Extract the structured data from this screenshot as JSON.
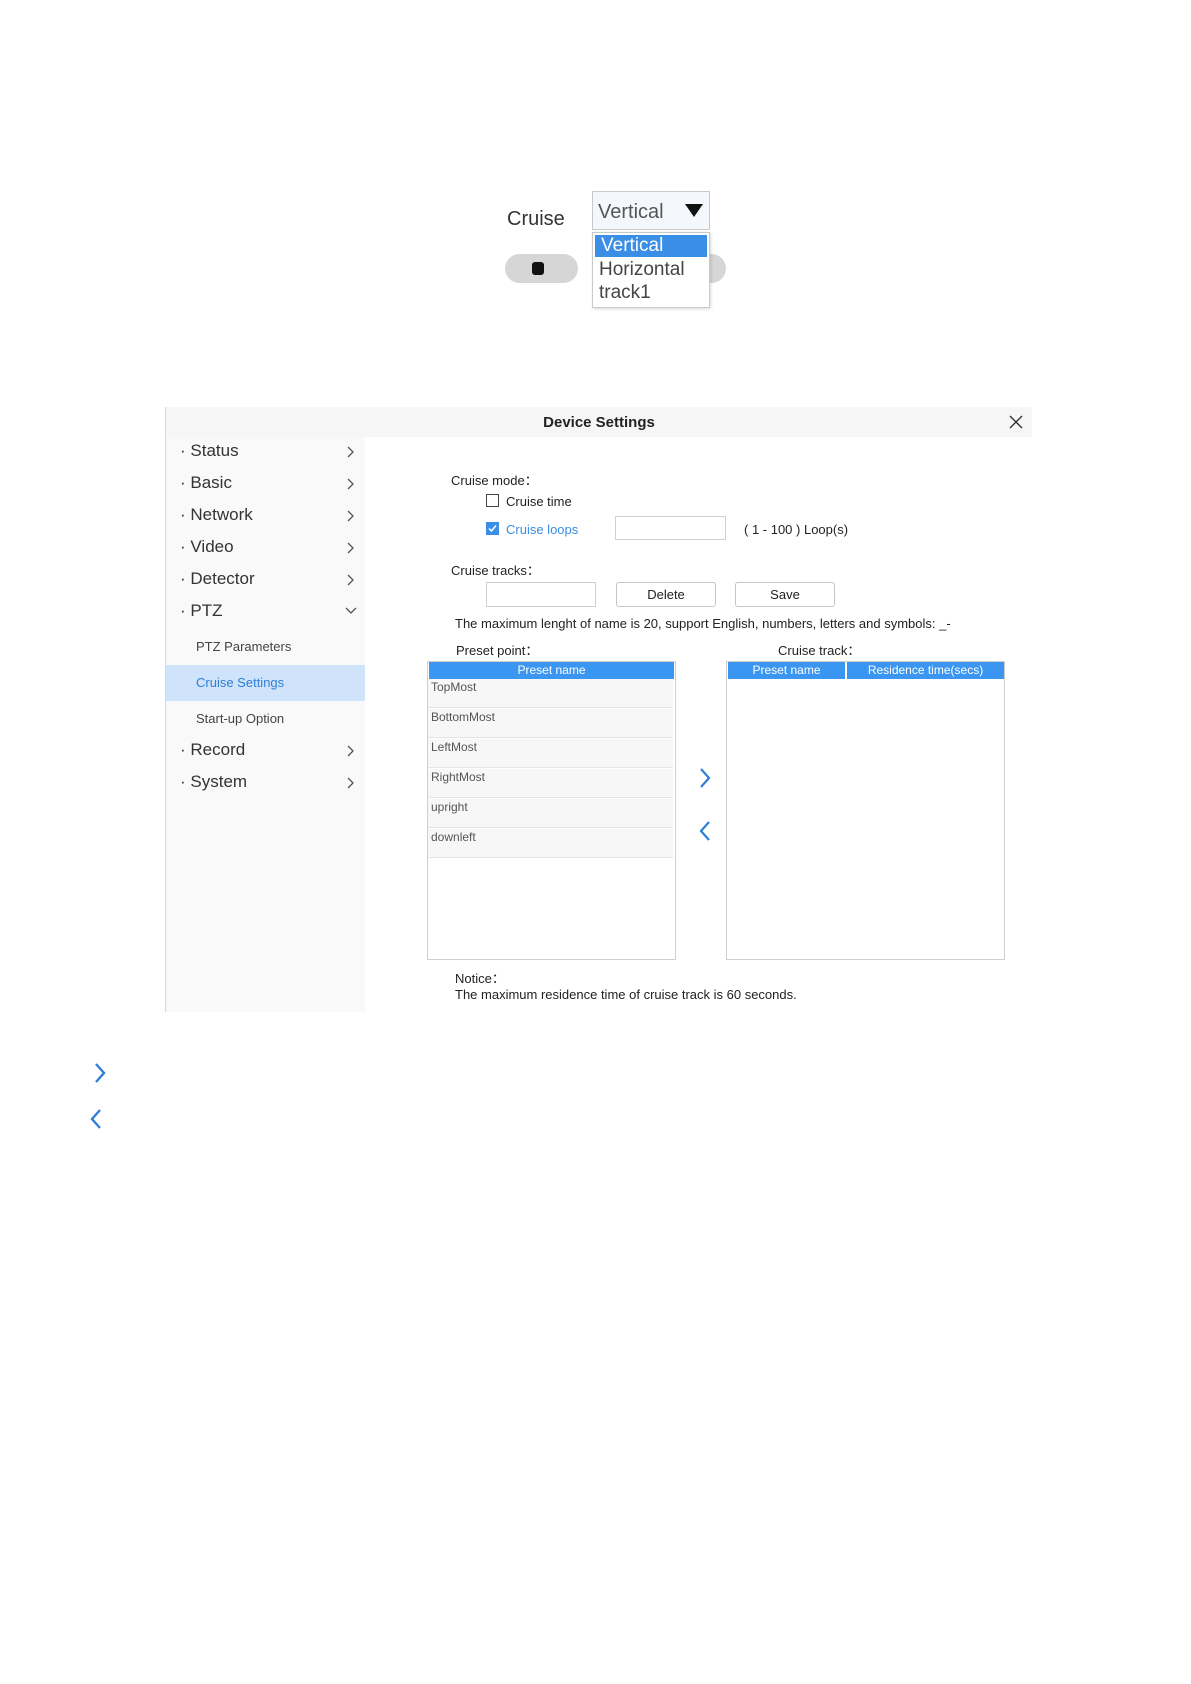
{
  "cruise_snippet": {
    "label": "Cruise",
    "select_value": "Vertical",
    "options": [
      "Vertical",
      "Horizontal",
      "track1"
    ],
    "selected_option": "Vertical"
  },
  "window": {
    "title": "Device Settings",
    "close_icon": "close-icon"
  },
  "sidebar": {
    "items": [
      {
        "label": "· Status"
      },
      {
        "label": "· Basic"
      },
      {
        "label": "· Network"
      },
      {
        "label": "· Video"
      },
      {
        "label": "· Detector"
      },
      {
        "label": "· PTZ"
      },
      {
        "label": "· Record"
      },
      {
        "label": "· System"
      }
    ],
    "ptz_sub": [
      {
        "label": "PTZ Parameters"
      },
      {
        "label": "Cruise Settings"
      },
      {
        "label": "Start-up Option"
      }
    ]
  },
  "cruise_mode": {
    "label": "Cruise mode：",
    "cruise_time": {
      "label": "Cruise time",
      "checked": false
    },
    "cruise_loops": {
      "label": "Cruise loops",
      "checked": true,
      "value": ""
    },
    "loops_range": "( 1 - 100 ) Loop(s)"
  },
  "cruise_tracks": {
    "label": "Cruise tracks：",
    "name_value": "",
    "delete_label": "Delete",
    "save_label": "Save",
    "hint": "The maximum lenght of name is 20, support English, numbers, letters and symbols: _-"
  },
  "preset_point": {
    "label": "Preset point：",
    "header": "Preset name",
    "rows": [
      "TopMost",
      "BottomMost",
      "LeftMost",
      "RightMost",
      "upright",
      "downleft"
    ]
  },
  "cruise_track": {
    "label": "Cruise track：",
    "headers": [
      "Preset name",
      "Residence time(secs)"
    ],
    "rows": []
  },
  "notice": {
    "label": "Notice：",
    "text": "The maximum residence time of cruise track is 60 seconds."
  },
  "colors": {
    "accent": "#3a96f0",
    "active_bg": "#cfe3fa"
  }
}
